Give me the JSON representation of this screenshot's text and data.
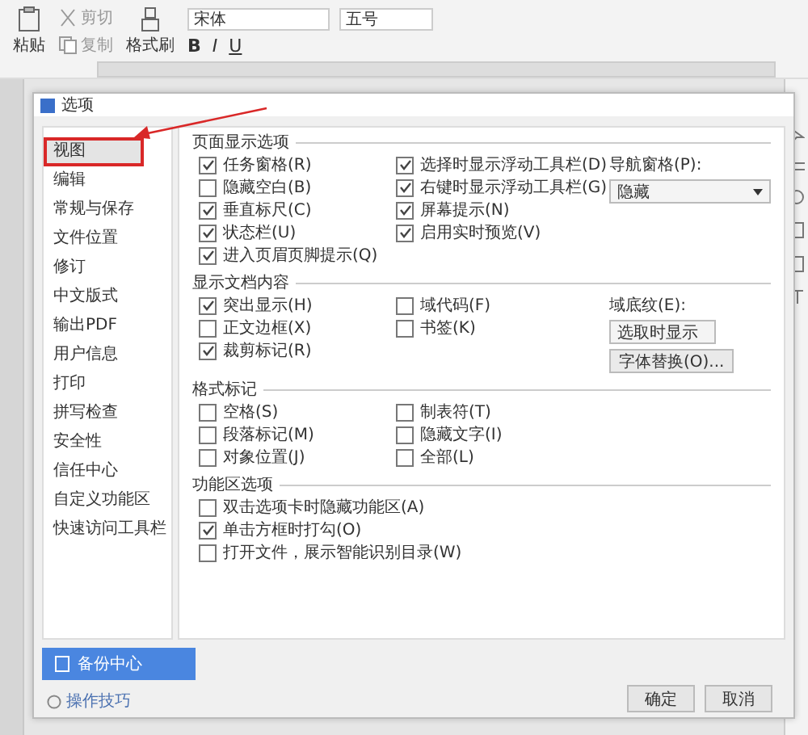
{
  "toolbar": {
    "clipboard": [
      {
        "kind": "paste",
        "label": "粘贴"
      },
      {
        "kind": "cut",
        "label": "剪切"
      },
      {
        "kind": "copy",
        "label": "复制"
      },
      {
        "kind": "painter",
        "label": "格式刷"
      }
    ],
    "font": "宋体",
    "font_size": "五号",
    "format_buttons": [
      "B",
      "I",
      "U"
    ]
  },
  "dialog": {
    "title": "选项",
    "sidebar": [
      {
        "label": "视图",
        "selected": true
      },
      {
        "label": "编辑",
        "selected": false
      },
      {
        "label": "常规与保存",
        "selected": false
      },
      {
        "label": "文件位置",
        "selected": false
      },
      {
        "label": "修订",
        "selected": false
      },
      {
        "label": "中文版式",
        "selected": false
      },
      {
        "label": "输出PDF",
        "selected": false
      },
      {
        "label": "用户信息",
        "selected": false
      },
      {
        "label": "打印",
        "selected": false
      },
      {
        "label": "拼写检查",
        "selected": false
      },
      {
        "label": "安全性",
        "selected": false
      },
      {
        "label": "信任中心",
        "selected": false
      },
      {
        "label": "自定义功能区",
        "selected": false
      },
      {
        "label": "快速访问工具栏",
        "selected": false
      }
    ],
    "sections": [
      {
        "title": "页面显示选项",
        "columns": [
          [
            {
              "label": "任务窗格(R)",
              "checked": true
            },
            {
              "label": "隐藏空白(B)",
              "checked": false
            },
            {
              "label": "垂直标尺(C)",
              "checked": true
            },
            {
              "label": "状态栏(U)",
              "checked": true
            },
            {
              "label": "进入页眉页脚提示(Q)",
              "checked": true
            }
          ],
          [
            {
              "label": "选择时显示浮动工具栏(D)",
              "checked": true
            },
            {
              "label": "右键时显示浮动工具栏(G)",
              "checked": true
            },
            {
              "label": "屏幕提示(N)",
              "checked": true
            },
            {
              "label": "启用实时预览(V)",
              "checked": true
            }
          ]
        ],
        "side": [
          {
            "kind": "dropdown",
            "label": "导航窗格(P):",
            "value": "隐藏"
          }
        ]
      },
      {
        "title": "显示文档内容",
        "columns": [
          [
            {
              "label": "突出显示(H)",
              "checked": true
            },
            {
              "label": "正文边框(X)",
              "checked": false
            },
            {
              "label": "裁剪标记(R)",
              "checked": true
            }
          ],
          [
            {
              "label": "域代码(F)",
              "checked": false
            },
            {
              "label": "书签(K)",
              "checked": false
            }
          ]
        ],
        "side": [
          {
            "kind": "dropdown",
            "label": "域底纹(E):",
            "value": "选取时显示"
          },
          {
            "kind": "button",
            "label": "字体替换(O)..."
          }
        ]
      },
      {
        "title": "格式标记",
        "columns": [
          [
            {
              "label": "空格(S)",
              "checked": false
            },
            {
              "label": "段落标记(M)",
              "checked": false
            },
            {
              "label": "对象位置(J)",
              "checked": false
            }
          ],
          [
            {
              "label": "制表符(T)",
              "checked": false
            },
            {
              "label": "隐藏文字(I)",
              "checked": false
            },
            {
              "label": "全部(L)",
              "checked": false
            }
          ]
        ]
      },
      {
        "title": "功能区选项",
        "columns": [
          [
            {
              "label": "双击选项卡时隐藏功能区(A)",
              "checked": false
            },
            {
              "label": "单击方框时打勾(O)",
              "checked": true
            },
            {
              "label": "打开文件，展示智能识别目录(W)",
              "checked": false
            }
          ]
        ]
      }
    ],
    "backup_button": "备份中心",
    "tips_link": "操作技巧",
    "buttons": [
      "确定",
      "取消"
    ]
  }
}
